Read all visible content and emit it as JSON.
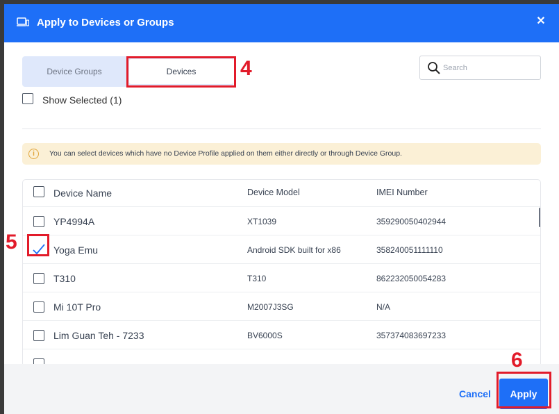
{
  "dialog": {
    "title": "Apply to Devices or Groups",
    "close_glyph": "✕",
    "header_icon": "devices-icon",
    "accent_color": "#1e6ff7"
  },
  "tabs": [
    {
      "label": "Device Groups",
      "active": false
    },
    {
      "label": "Devices",
      "active": true
    }
  ],
  "search": {
    "placeholder": "Search",
    "value": ""
  },
  "show_selected": {
    "label": "Show Selected (1)",
    "checked": false
  },
  "notice": {
    "icon": "info-icon",
    "icon_glyph": "i",
    "text": "You can select devices which have no Device Profile applied on them either directly or through Device Group."
  },
  "table": {
    "columns": [
      "Device Name",
      "Device Model",
      "IMEI Number"
    ],
    "rows": [
      {
        "name": "YP4994A",
        "model": "XT1039",
        "imei": "359290050402944",
        "checked": false
      },
      {
        "name": "Yoga Emu",
        "model": "Android SDK built for x86",
        "imei": "358240051111110",
        "checked": true
      },
      {
        "name": "T310",
        "model": "T310",
        "imei": "862232050054283",
        "checked": false
      },
      {
        "name": "Mi 10T Pro",
        "model": "M2007J3SG",
        "imei": "N/A",
        "checked": false
      },
      {
        "name": "Lim Guan Teh - 7233",
        "model": "BV6000S",
        "imei": "357374083697233",
        "checked": false
      }
    ]
  },
  "footer": {
    "cancel_label": "Cancel",
    "apply_label": "Apply"
  },
  "annotations": {
    "step_4": "4",
    "step_5": "5",
    "step_6": "6",
    "color": "#e21b2a"
  }
}
